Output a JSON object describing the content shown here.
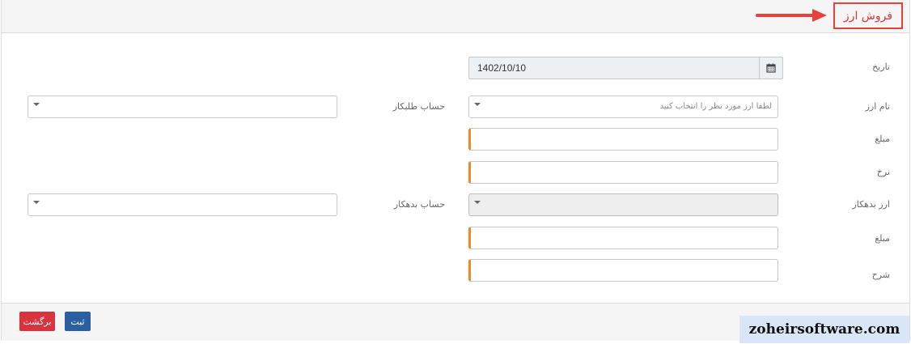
{
  "header": {
    "title": "فروش ارز",
    "accent_color": "#e8413b"
  },
  "form": {
    "date": {
      "label": "تاریخ",
      "value": "1402/10/10"
    },
    "currency_name": {
      "label": "نام ارز",
      "placeholder": "لطفا ارز مورد نظر را انتخاب کنید"
    },
    "creditor_account": {
      "label": "حساب طلبکار"
    },
    "amount": {
      "label": "مبلغ",
      "value": ""
    },
    "rate": {
      "label": "نرخ",
      "value": ""
    },
    "debtor_currency": {
      "label": "ارز بدهکار"
    },
    "debtor_account": {
      "label": "حساب بدهکار"
    },
    "amount2": {
      "label": "مبلغ",
      "value": ""
    },
    "description": {
      "label": "شرح",
      "value": ""
    }
  },
  "footer": {
    "back_label": "برگشت",
    "save_label": "ثبت",
    "back_color": "#d8333f",
    "save_color": "#2a5fa1"
  },
  "watermark": "zoheirsoftware.com"
}
